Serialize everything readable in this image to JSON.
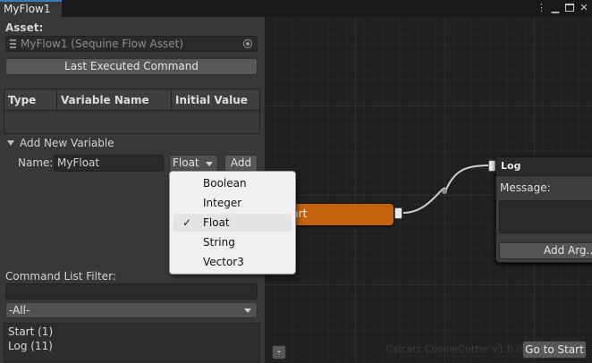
{
  "window": {
    "tab_title": "MyFlow1",
    "menu_icon": "⋮",
    "minimize_icon": "▁",
    "close_icon": "✕"
  },
  "asset": {
    "label": "Asset:",
    "value": "MyFlow1 (Sequine Flow Asset)"
  },
  "last_executed_button": "Last Executed Command",
  "variables_table": {
    "columns": [
      "Type",
      "Variable Name",
      "Initial Value"
    ],
    "rows": []
  },
  "add_new_variable": {
    "foldout_label": "Add New Variable",
    "name_label": "Name:",
    "name_value": "MyFloat",
    "type_selected": "Float",
    "add_button": "Add"
  },
  "type_menu": {
    "options": [
      "Boolean",
      "Integer",
      "Float",
      "String",
      "Vector3"
    ],
    "selected": "Float",
    "check_mark": "✓"
  },
  "command_filter": {
    "label": "Command List Filter:",
    "value": "",
    "category": "-All-"
  },
  "command_list": [
    "Start (1)",
    "Log (11)"
  ],
  "graph": {
    "start_node": {
      "label": "Start",
      "color": "#c4620d"
    },
    "log_node": {
      "title": "Log",
      "message_label": "Message:",
      "add_arg_button": "Add Arg..."
    },
    "watermark": "Calcatz CookieCutter v1.0.0",
    "go_to_start_button": "Go to Start",
    "minus_button": "-"
  },
  "colors": {
    "accent": "#3a79bb",
    "panel": "#383838",
    "graph_bg": "#202020"
  }
}
